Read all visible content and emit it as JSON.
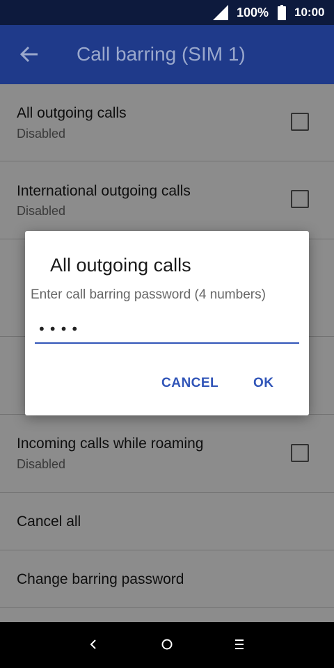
{
  "status_bar": {
    "battery": "100%",
    "time": "10:00"
  },
  "app_bar": {
    "title": "Call barring (SIM 1)"
  },
  "rows": [
    {
      "title": "All outgoing calls",
      "subtitle": "Disabled",
      "checked": false
    },
    {
      "title": "International outgoing calls",
      "subtitle": "Disabled",
      "checked": false
    },
    {
      "title": "Incoming calls while roaming",
      "subtitle": "Disabled",
      "checked": false
    },
    {
      "title": "Cancel all"
    },
    {
      "title": "Change barring password"
    }
  ],
  "dialog": {
    "title": "All outgoing calls",
    "message": "Enter call barring password (4 numbers)",
    "password": "1234",
    "cancel_label": "CANCEL",
    "ok_label": "OK"
  },
  "colors": {
    "status_bar": "#0d1a3d",
    "app_bar": "#1f3a8a",
    "accent": "#3155b8"
  }
}
